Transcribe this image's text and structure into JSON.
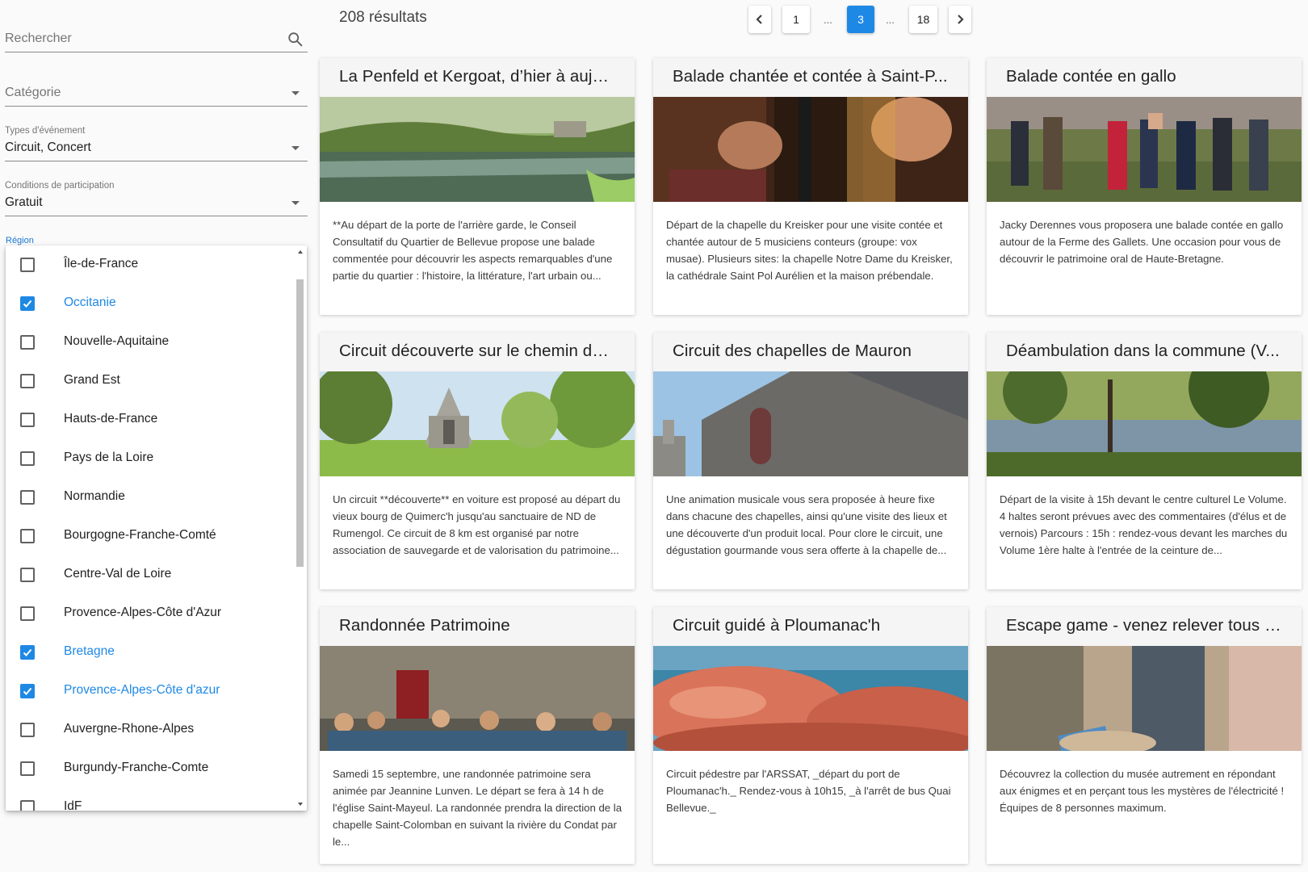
{
  "sidebar": {
    "search": {
      "placeholder": "Rechercher"
    },
    "category": {
      "placeholder": "Catégorie"
    },
    "event_types": {
      "label": "Types d'événement",
      "value": "Circuit, Concert"
    },
    "participation": {
      "label": "Conditions de participation",
      "value": "Gratuit"
    },
    "region": {
      "label": "Région",
      "options": [
        {
          "label": "Île-de-France",
          "checked": false
        },
        {
          "label": "Occitanie",
          "checked": true
        },
        {
          "label": "Nouvelle-Aquitaine",
          "checked": false
        },
        {
          "label": "Grand Est",
          "checked": false
        },
        {
          "label": "Hauts-de-France",
          "checked": false
        },
        {
          "label": "Pays de la Loire",
          "checked": false
        },
        {
          "label": "Normandie",
          "checked": false
        },
        {
          "label": "Bourgogne-Franche-Comté",
          "checked": false
        },
        {
          "label": "Centre-Val de Loire",
          "checked": false
        },
        {
          "label": "Provence-Alpes-Côte d'Azur",
          "checked": false
        },
        {
          "label": "Bretagne",
          "checked": true
        },
        {
          "label": "Provence-Alpes-Côte d'azur",
          "checked": true
        },
        {
          "label": "Auvergne-Rhone-Alpes",
          "checked": false
        },
        {
          "label": "Burgundy-Franche-Comte",
          "checked": false
        },
        {
          "label": "IdF",
          "checked": false
        }
      ]
    }
  },
  "header": {
    "results": "208 résultats",
    "pagination": {
      "first": "1",
      "ellipsis": "...",
      "current": "3",
      "last": "18"
    }
  },
  "colors": {
    "accent": "#1e88e5"
  },
  "cards": [
    {
      "title": "La Penfeld et Kergoat, d’hier à aujo...",
      "image": "river-landscape",
      "description": "**Au départ de la porte de l'arrière garde, le Conseil Consultatif du Quartier de Bellevue propose une balade commentée pour découvrir les aspects remarquables d'une partie du quartier : l'histoire, la littérature, l'art urbain ou..."
    },
    {
      "title": "Balade chantée et contée à Saint-P...",
      "image": "musician-closeup",
      "description": "Départ de la chapelle du Kreisker pour une visite contée et chantée autour de 5 musiciens conteurs (groupe: vox musae). Plusieurs sites: la chapelle Notre Dame du Kreisker, la cathédrale Saint Pol Aurélien et la maison prébendale."
    },
    {
      "title": "Balade contée en gallo",
      "image": "group-in-field",
      "description": "Jacky Derennes vous proposera une balade contée en gallo autour de la Ferme des Gallets. Une occasion pour vous de découvrir le patrimoine oral de Haute-Bretagne."
    },
    {
      "title": "Circuit découverte sur le chemin de...",
      "image": "chapel-in-trees",
      "description": "Un circuit **découverte** en voiture est proposé au départ du vieux bourg de Quimerc'h jusqu'au sanctuaire de ND de Rumengol. Ce circuit de 8 km est organisé par notre association de sauvegarde et de valorisation du patrimoine..."
    },
    {
      "title": "Circuit des chapelles de Mauron",
      "image": "stone-chapel",
      "description": "Une animation musicale vous sera proposée à heure fixe dans chacune des chapelles, ainsi qu'une visite des lieux et une découverte d'un produit local. Pour clore le circuit, une dégustation gourmande vous sera offerte à la chapelle de..."
    },
    {
      "title": "Déambulation dans la commune (V...",
      "image": "pond-trees",
      "description": "Départ de la visite à 15h devant le centre culturel Le Volume. 4 haltes seront prévues avec des commentaires (d'élus et de vernois) Parcours : 15h : rendez-vous devant les marches du Volume 1ère halte à l'entrée de la ceinture de..."
    },
    {
      "title": "Randonnée Patrimoine",
      "image": "church-door-crowd",
      "description": "Samedi 15 septembre, une randonnée patrimoine sera animée par Jeannine Lunven. Le départ se fera à 14 h de l'église Saint-Mayeul. La randonnée prendra la direction de la chapelle Saint-Colomban en suivant la rivière du Condat par le..."
    },
    {
      "title": "Circuit guidé à Ploumanac'h",
      "image": "pink-granite-rocks",
      "description": "Circuit pédestre par l'ARSSAT, _départ du port de Ploumanac'h._ Rendez-vous à 10h15, _à l'arrêt de bus Quai Bellevue._"
    },
    {
      "title": "Escape game - venez relever tous l...",
      "image": "museum-game",
      "description": "Découvrez la collection du musée autrement en répondant aux énigmes et en perçant tous les mystères de l'électricité ! Équipes de 8 personnes maximum."
    }
  ]
}
